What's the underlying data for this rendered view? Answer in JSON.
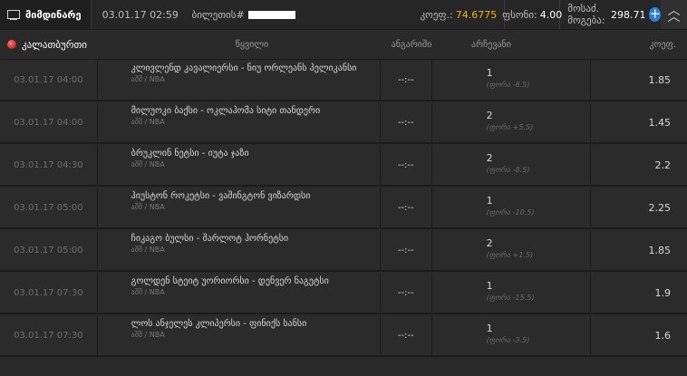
{
  "topbar": {
    "live_label": "მიმდინარე",
    "datetime": "03.01.17 02:59",
    "ticket_label": "ბილეთის#",
    "coef_label": "კოეფ.:",
    "coef_value": "74.6775",
    "amount_label": "ფსონი:",
    "amount_value": "4.00",
    "win_label": "მოსაძ. მოგება:",
    "win_value": "298.71",
    "plus_symbol": "+",
    "chevron_symbol": "︿"
  },
  "header": {
    "calendar_label": "კალათბურთი",
    "event_col": "წყვილი",
    "score_col": "ანგარიში",
    "outcome_col": "არჩევანი",
    "coef_col": "კოეფ."
  },
  "rows": [
    {
      "date": "03.01.17 04:00",
      "event": "კლივლენდ კავალიერსი - ნიუ ორლეანს პელიკანსი",
      "league": "აშშ / NBA",
      "score": "--:--",
      "outcome": "1",
      "handicap": "(ფორა -8.5)",
      "coef": "1.85"
    },
    {
      "date": "03.01.17 04:00",
      "event": "მილუოკი ბაქსი - ოკლაჰომა სიტი თანდერი",
      "league": "აშშ / NBA",
      "score": "--:--",
      "outcome": "2",
      "handicap": "(ფორა +5.5)",
      "coef": "1.45"
    },
    {
      "date": "03.01.17 04:30",
      "event": "ბრუკლინ ნეტსი - იუტა ჯაზი",
      "league": "აშშ / NBA",
      "score": "--:--",
      "outcome": "2",
      "handicap": "(ფორა -8.5)",
      "coef": "2.2"
    },
    {
      "date": "03.01.17 05:00",
      "event": "ჰიუსტონ როკეტსი - ვაშინგტონ ვიზარდსი",
      "league": "აშშ / NBA",
      "score": "--:--",
      "outcome": "1",
      "handicap": "(ფორა -10.5)",
      "coef": "2.25"
    },
    {
      "date": "03.01.17 05:00",
      "event": "ჩიკაგო ბულსი - შარლოტ ჰორნეტსი",
      "league": "აშშ / NBA",
      "score": "--:--",
      "outcome": "2",
      "handicap": "(ფორა +1.5)",
      "coef": "1.85"
    },
    {
      "date": "03.01.17 07:30",
      "event": "გოლდენ სტეიტ უორიორსი - დენვერ ნაგეტსი",
      "league": "აშშ / NBA",
      "score": "--:--",
      "outcome": "1",
      "handicap": "(ფორა -15.5)",
      "coef": "1.9"
    },
    {
      "date": "03.01.17 07:30",
      "event": "ლოს ანჯელეს კლიპერსი - ფინიქს სანსი",
      "league": "აშშ / NBA",
      "score": "--:--",
      "outcome": "1",
      "handicap": "(ფორა -3.5)",
      "coef": "1.6"
    }
  ]
}
